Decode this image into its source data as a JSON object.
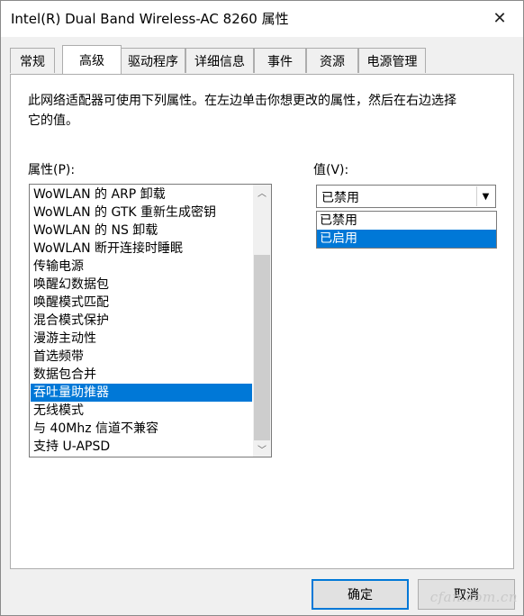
{
  "window": {
    "title": "Intel(R) Dual Band Wireless-AC 8260 属性",
    "close_icon": "close-icon"
  },
  "tabs": [
    {
      "label": "常规",
      "active": false
    },
    {
      "label": "高级",
      "active": true
    },
    {
      "label": "驱动程序",
      "active": false
    },
    {
      "label": "详细信息",
      "active": false
    },
    {
      "label": "事件",
      "active": false
    },
    {
      "label": "资源",
      "active": false
    },
    {
      "label": "电源管理",
      "active": false
    }
  ],
  "panel": {
    "description": "此网络适配器可使用下列属性。在左边单击你想更改的属性，然后在右边选择它的值。",
    "properties_label": "属性(P):",
    "value_label": "值(V):"
  },
  "properties": {
    "items": [
      "WoWLAN 的 ARP 卸载",
      "WoWLAN 的 GTK 重新生成密钥",
      "WoWLAN 的 NS 卸载",
      "WoWLAN 断开连接时睡眠",
      "传输电源",
      "唤醒幻数据包",
      "唤醒模式匹配",
      "混合模式保护",
      "漫游主动性",
      "首选频带",
      "数据包合并",
      "吞吐量助推器",
      "无线模式",
      "与 40Mhz 信道不兼容",
      "支持 U-APSD"
    ],
    "selected_index": 11
  },
  "value": {
    "current": "已禁用",
    "options": [
      "已禁用",
      "已启用"
    ],
    "highlighted_index": 1
  },
  "buttons": {
    "ok": "确定",
    "cancel": "取消"
  },
  "watermark": "cfan.com.cn"
}
